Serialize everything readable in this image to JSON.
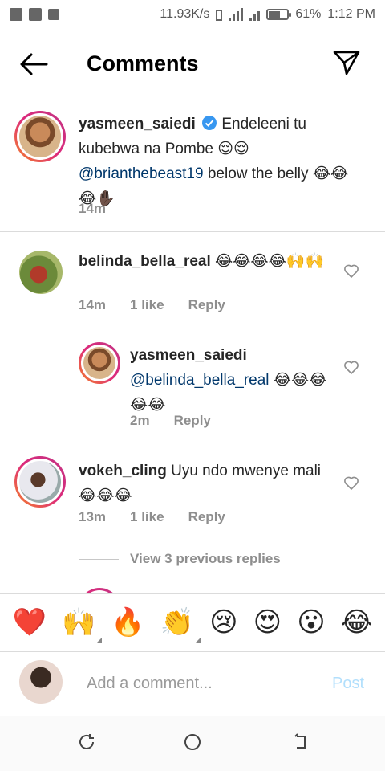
{
  "status_bar": {
    "speed": "11.93K/s",
    "battery": "61%",
    "battery_level": 0.61,
    "time": "1:12 PM"
  },
  "header": {
    "title": "Comments"
  },
  "comments": [
    {
      "username": "yasmeen_saiedi",
      "verified": true,
      "text_1": "Endeleeni tu kubebwa na Pombe",
      "emoji_1": "😌😌",
      "mention": "@brianthebeast19",
      "text_2": "below the belly",
      "emoji_2": "😂😂😂✋🏿",
      "time": "14m"
    },
    {
      "username": "belinda_bella_real",
      "text": "",
      "emoji": "😂😂😂😂🙌🙌",
      "time": "14m",
      "likes": "1 like",
      "reply": "Reply",
      "replies": [
        {
          "username": "yasmeen_saiedi",
          "mention": "@belinda_bella_real",
          "emoji": "😂😂😂😂😂",
          "time": "2m",
          "reply": "Reply"
        }
      ]
    },
    {
      "username": "vokeh_cling",
      "text": "Uyu ndo mwenye mali",
      "emoji": "😂😂😂",
      "time": "13m",
      "likes": "1 like",
      "reply": "Reply",
      "view_replies": "View 3 previous replies"
    }
  ],
  "quick_emojis": [
    "❤️",
    "🙌",
    "🔥",
    "👏",
    "😢",
    "😍",
    "😮",
    "😂"
  ],
  "add_comment": {
    "placeholder": "Add a comment...",
    "post": "Post"
  },
  "colors": {
    "mention": "#00376b",
    "meta": "#8e8e8e",
    "post_disabled": "#b2dffc",
    "verified": "#3897f0"
  }
}
